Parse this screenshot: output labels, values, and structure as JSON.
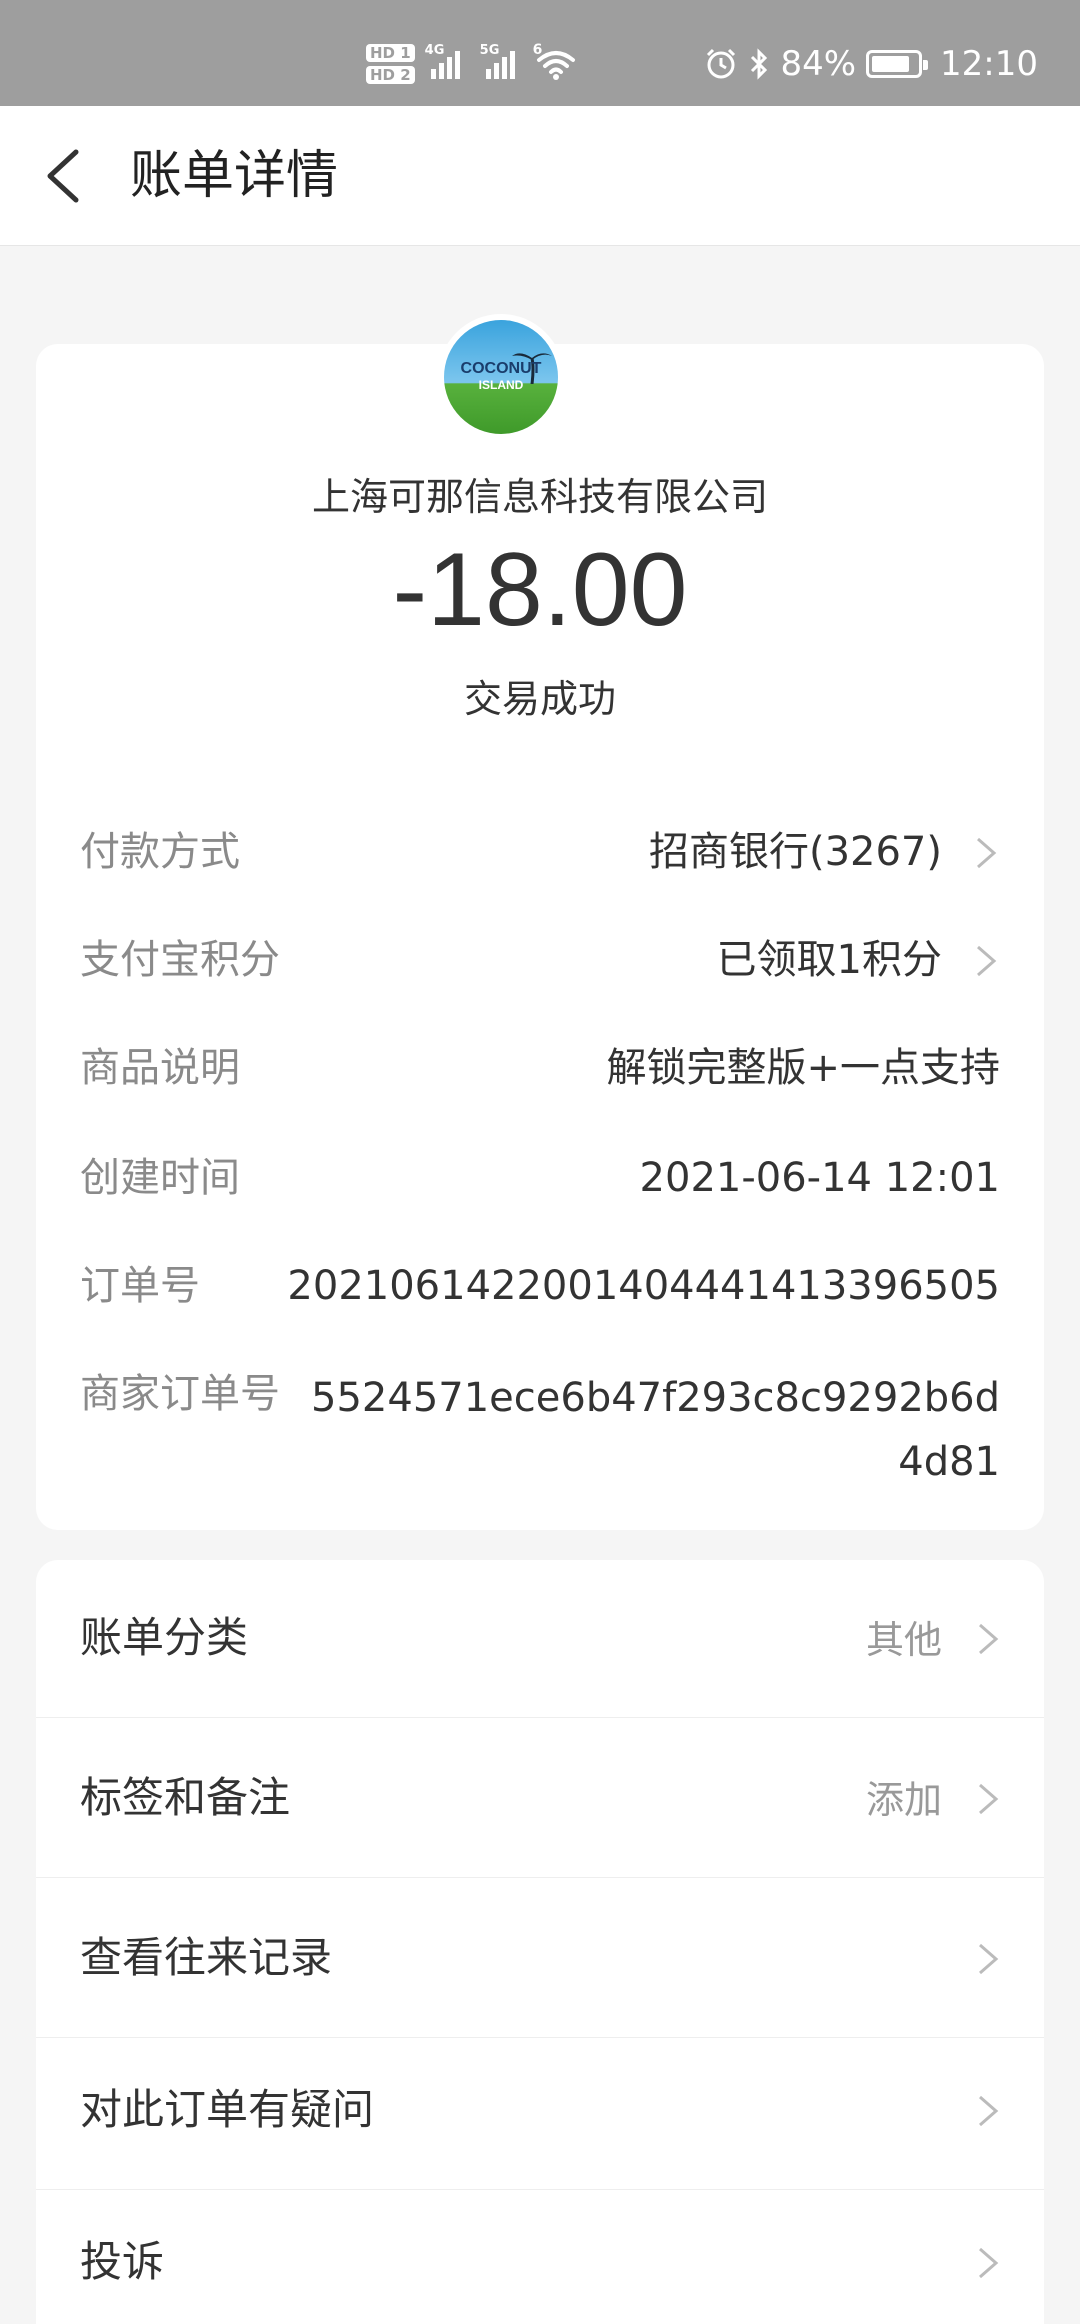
{
  "status_bar": {
    "hd1": "HD 1",
    "hd2": "HD 2",
    "net1": "4G",
    "net2": "5G",
    "wifi_badge": "6",
    "battery": "84%",
    "time": "12:10"
  },
  "header": {
    "title": "账单详情"
  },
  "merchant": {
    "logo_text": "COCONUT",
    "logo_subtext": "ISLAND",
    "name": "上海可那信息科技有限公司",
    "amount": "-18.00",
    "status": "交易成功"
  },
  "details": {
    "payment_method": {
      "label": "付款方式",
      "value": "招商银行(3267)"
    },
    "points": {
      "label": "支付宝积分",
      "value": "已领取1积分"
    },
    "product": {
      "label": "商品说明",
      "value": "解锁完整版+一点支持"
    },
    "created": {
      "label": "创建时间",
      "value": "2021-06-14 12:01"
    },
    "order_no": {
      "label": "订单号",
      "value": "2021061422001404441413396505"
    },
    "merchant_order_no": {
      "label": "商家订单号",
      "value": "5524571ece6b47f293c8c9292b6d4d81"
    }
  },
  "actions": [
    {
      "label": "账单分类",
      "value": "其他"
    },
    {
      "label": "标签和备注",
      "value": "添加"
    },
    {
      "label": "查看往来记录",
      "value": ""
    },
    {
      "label": "对此订单有疑问",
      "value": ""
    },
    {
      "label": "投诉",
      "value": ""
    }
  ],
  "colors": {
    "status_bar": "#9e9e9e",
    "background": "#f5f5f5",
    "card": "#ffffff",
    "label_gray": "#8a8a8a"
  }
}
